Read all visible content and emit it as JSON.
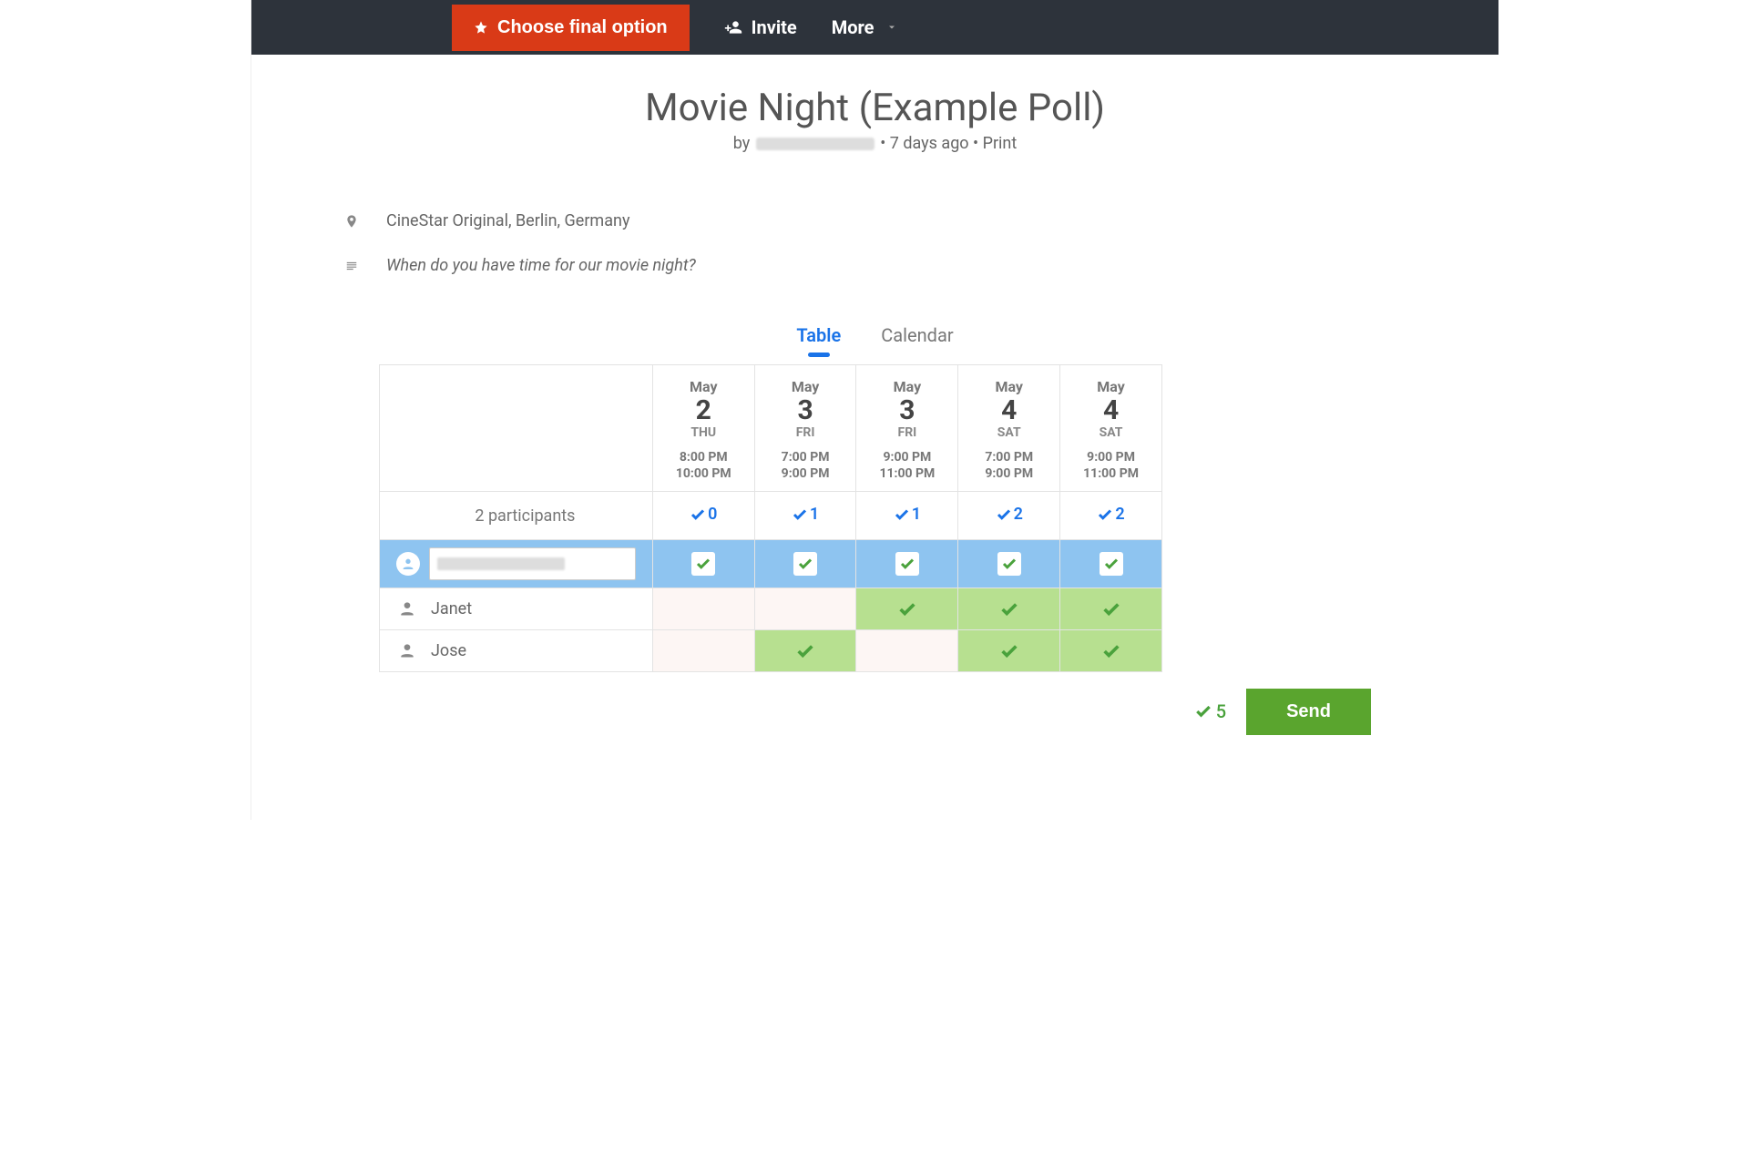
{
  "topbar": {
    "choose_label": "Choose final option",
    "invite_label": "Invite",
    "more_label": "More"
  },
  "poll": {
    "title": "Movie Night (Example Poll)",
    "by_prefix": "by",
    "time_ago": "7 days ago",
    "print_label": "Print",
    "location": "CineStar Original, Berlin, Germany",
    "description": "When do you have time for our movie night?"
  },
  "tabs": {
    "table": "Table",
    "calendar": "Calendar"
  },
  "options": [
    {
      "month": "May",
      "day": "2",
      "dow": "THU",
      "time_start": "8:00 PM",
      "time_end": "10:00 PM"
    },
    {
      "month": "May",
      "day": "3",
      "dow": "FRI",
      "time_start": "7:00 PM",
      "time_end": "9:00 PM"
    },
    {
      "month": "May",
      "day": "3",
      "dow": "FRI",
      "time_start": "9:00 PM",
      "time_end": "11:00 PM"
    },
    {
      "month": "May",
      "day": "4",
      "dow": "SAT",
      "time_start": "7:00 PM",
      "time_end": "9:00 PM"
    },
    {
      "month": "May",
      "day": "4",
      "dow": "SAT",
      "time_start": "9:00 PM",
      "time_end": "11:00 PM"
    }
  ],
  "summary": {
    "label": "2 participants",
    "counts": [
      "0",
      "1",
      "1",
      "2",
      "2"
    ]
  },
  "my_row": {
    "votes": [
      true,
      true,
      true,
      true,
      true
    ]
  },
  "participants": [
    {
      "name": "Janet",
      "votes": [
        false,
        false,
        true,
        true,
        true
      ]
    },
    {
      "name": "Jose",
      "votes": [
        false,
        true,
        false,
        true,
        true
      ]
    }
  ],
  "footer": {
    "my_yes_count": "5",
    "send_label": "Send"
  }
}
